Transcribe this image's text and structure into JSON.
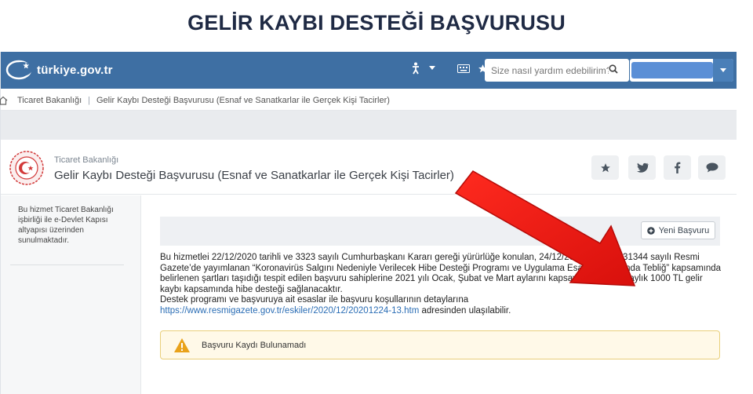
{
  "headline": "GELİR KAYBI DESTEĞİ BAŞVURUSU",
  "topbar": {
    "logo_text": "türkiye.gov.tr",
    "search_placeholder": "Size nasıl yardım edebilirim?",
    "icons": [
      "accessibility-icon",
      "chevron-down-icon",
      "keyboard-icon",
      "star-icon",
      "search-icon"
    ],
    "bg_color": "#3e6fa3"
  },
  "breadcrumb": {
    "items": [
      "Ticaret Bakanlığı",
      "Gelir Kaybı Desteği Başvurusu (Esnaf ve Sanatkarlar ile Gerçek Kişi Tacirler)"
    ]
  },
  "service_header": {
    "ministry": "Ticaret Bakanlığı",
    "title": "Gelir Kaybı Desteği Başvurusu (Esnaf ve Sanatkarlar ile Gerçek Kişi Tacirler)",
    "share_icons": [
      "star-icon",
      "twitter-icon",
      "facebook-icon",
      "comment-icon"
    ]
  },
  "sidebar": {
    "note": "Bu hizmet Ticaret Bakanlığı işbirliği ile e-Devlet Kapısı altyapısı üzerinden sunulmaktadır."
  },
  "main": {
    "new_application_label": "Yeni Başvuru",
    "description": "Bu hizmetlei 22/12/2020 tarihli ve 3323 sayılı Cumhurbaşkanı Kararı gereği yürürlüğe konulan, 24/12/2020 tarihli ve 31344 sayılı Resmi Gazete’de yayımlanan “Koronavirüs Salgını Nedeniyle Verilecek Hibe Desteği Programı ve Uygulama Esasları Hakkında Tebliğ” kapsamında belirlenen şartları taşıdığı tespit edilen başvuru sahiplerine 2021 yılı Ocak, Şubat ve Mart aylarını kapsayacak şekilde aylık 1000 TL gelir kaybı kapsamında hibe desteği sağlanacaktır.",
    "description_2": "Destek programı ve başvuruya ait esaslar ile başvuru koşullarının detaylarına",
    "link": "https://www.resmigazete.gov.tr/eskiler/2020/12/20201224-13.htm",
    "link_suffix": " adresinden ulaşılabilir.",
    "alert": "Başvuru Kaydı Bulunamadı",
    "alert_color": "#e9a21a"
  },
  "annotation": {
    "arrow_color": "#e8130f"
  }
}
